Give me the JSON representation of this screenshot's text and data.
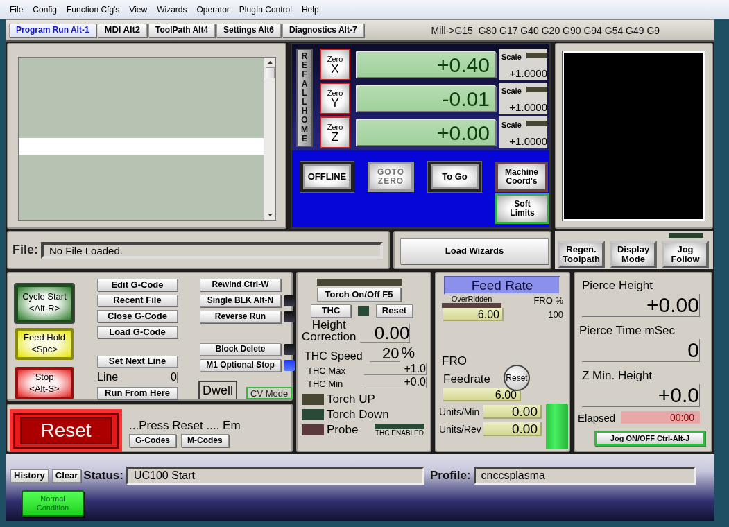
{
  "menu": [
    "File",
    "Config",
    "Function Cfg's",
    "View",
    "Wizards",
    "Operator",
    "PlugIn Control",
    "Help"
  ],
  "tabs": [
    {
      "label": "Program Run Alt-1",
      "selected": true
    },
    {
      "label": "MDI Alt2",
      "selected": false
    },
    {
      "label": "ToolPath Alt4",
      "selected": false
    },
    {
      "label": "Settings Alt6",
      "selected": false
    },
    {
      "label": "Diagnostics Alt-7",
      "selected": false
    }
  ],
  "modal_line": "Mill->G15  G80 G17 G40 G20 G90 G94 G54 G49 G9",
  "dro": {
    "ref_all_home": "REF ALL HOME",
    "axes": [
      {
        "zero": "Zero",
        "axis": "X",
        "value": "+0.40",
        "scale_label": "Scale",
        "scale": "+1.0000",
        "scale_led_on": false
      },
      {
        "zero": "Zero",
        "axis": "Y",
        "value": "-0.01",
        "scale_label": "Scale",
        "scale": "+1.0000",
        "scale_led_on": false
      },
      {
        "zero": "Zero",
        "axis": "Z",
        "value": "+0.00",
        "scale_label": "Scale",
        "scale": "+1.0000",
        "scale_led_on": false
      }
    ],
    "buttons": [
      {
        "label": "OFFLINE",
        "kind": "raised"
      },
      {
        "label": "GOTO\nZERO",
        "kind": "engraved"
      },
      {
        "label": "To Go",
        "kind": "raised"
      },
      {
        "label": "Machine\nCoord's",
        "kind": "framed"
      }
    ],
    "soft_limits": {
      "label": "Soft\nLimits",
      "active": true
    }
  },
  "file": {
    "label": "File:",
    "value": "No File Loaded."
  },
  "load_wizards": "Load Wizards",
  "view": {
    "buttons": [
      "Regen.\nToolpath",
      "Display\nMode",
      "Jog\nFollow"
    ],
    "led_on": false
  },
  "program": {
    "cycle_start": "Cycle Start\n<Alt-R>",
    "feed_hold": "Feed Hold\n<Spc>",
    "stop": "Stop\n<Alt-S>",
    "file_buttons": [
      "Edit G-Code",
      "Recent File",
      "Close G-Code",
      "Load G-Code"
    ],
    "set_next_line": "Set Next Line",
    "line_label": "Line",
    "line_value": "0",
    "run_from_here": "Run From Here",
    "toggles": [
      {
        "label": "Rewind Ctrl-W",
        "kind": "plain"
      },
      {
        "label": "Single BLK Alt-N",
        "kind": "led",
        "led_on": false
      },
      {
        "label": "Reverse Run",
        "kind": "led",
        "led_on": false
      },
      {
        "label": "Block Delete",
        "kind": "led",
        "led_on": false
      },
      {
        "label": "M1 Optional Stop",
        "kind": "led",
        "led_on": true
      }
    ],
    "dwell": {
      "label": "Dwell",
      "active": false
    },
    "cv_mode": {
      "label": "CV Mode",
      "active": true
    }
  },
  "reset": {
    "label": "Reset",
    "message": "...Press Reset .... Em",
    "buttons": [
      "G-Codes",
      "M-Codes"
    ]
  },
  "thc": {
    "torch_led_on": false,
    "torch_button": "Torch On/Off F5",
    "thc_button": "THC",
    "thc_led_on": false,
    "reset_button": "Reset",
    "fields": [
      {
        "label": "Height\nCorrection",
        "value": "0.00",
        "kind": "large"
      },
      {
        "label": "THC Speed",
        "value": "20",
        "unit": "%",
        "kind": "medium"
      },
      {
        "label": "THC Max",
        "value": "+1.0",
        "kind": "small"
      },
      {
        "label": "THC Min",
        "value": "+0.0",
        "kind": "small"
      }
    ],
    "indicators": [
      {
        "label": "Torch UP",
        "on": false
      },
      {
        "label": "Torch Down",
        "on": false
      },
      {
        "label": "Probe",
        "on": false
      }
    ],
    "enabled": {
      "label": "THC ENABLED",
      "on": false
    }
  },
  "feed": {
    "title": "Feed Rate",
    "overridden": {
      "label": "OverRidden",
      "on": false
    },
    "fro_percent_label": "FRO %",
    "programmed": "6.00",
    "fro_value": "100",
    "fro_label": "FRO",
    "reset": "Reset",
    "feedrate_label": "Feedrate",
    "feedrate": "6.00",
    "units_min_label": "Units/Min",
    "units_min": "0.00",
    "units_rev_label": "Units/Rev",
    "units_rev": "0.00",
    "indicator_on": true
  },
  "plasma": {
    "fields": [
      {
        "label": "Pierce Height",
        "value": "+0.00"
      },
      {
        "label": "Pierce Time mSec",
        "value": "0"
      },
      {
        "label": "Z Min. Height",
        "value": "+0.0"
      }
    ],
    "elapsed_label": "Elapsed",
    "elapsed": "00:00",
    "jog_button": {
      "label": "Jog ON/OFF Ctrl-Alt-J",
      "active": true
    }
  },
  "status": {
    "history": "History",
    "clear": "Clear",
    "status_label": "Status:",
    "status": "UC100 Start",
    "profile_label": "Profile:",
    "profile": "cnccsplasma",
    "condition": "Normal\nCondition"
  }
}
